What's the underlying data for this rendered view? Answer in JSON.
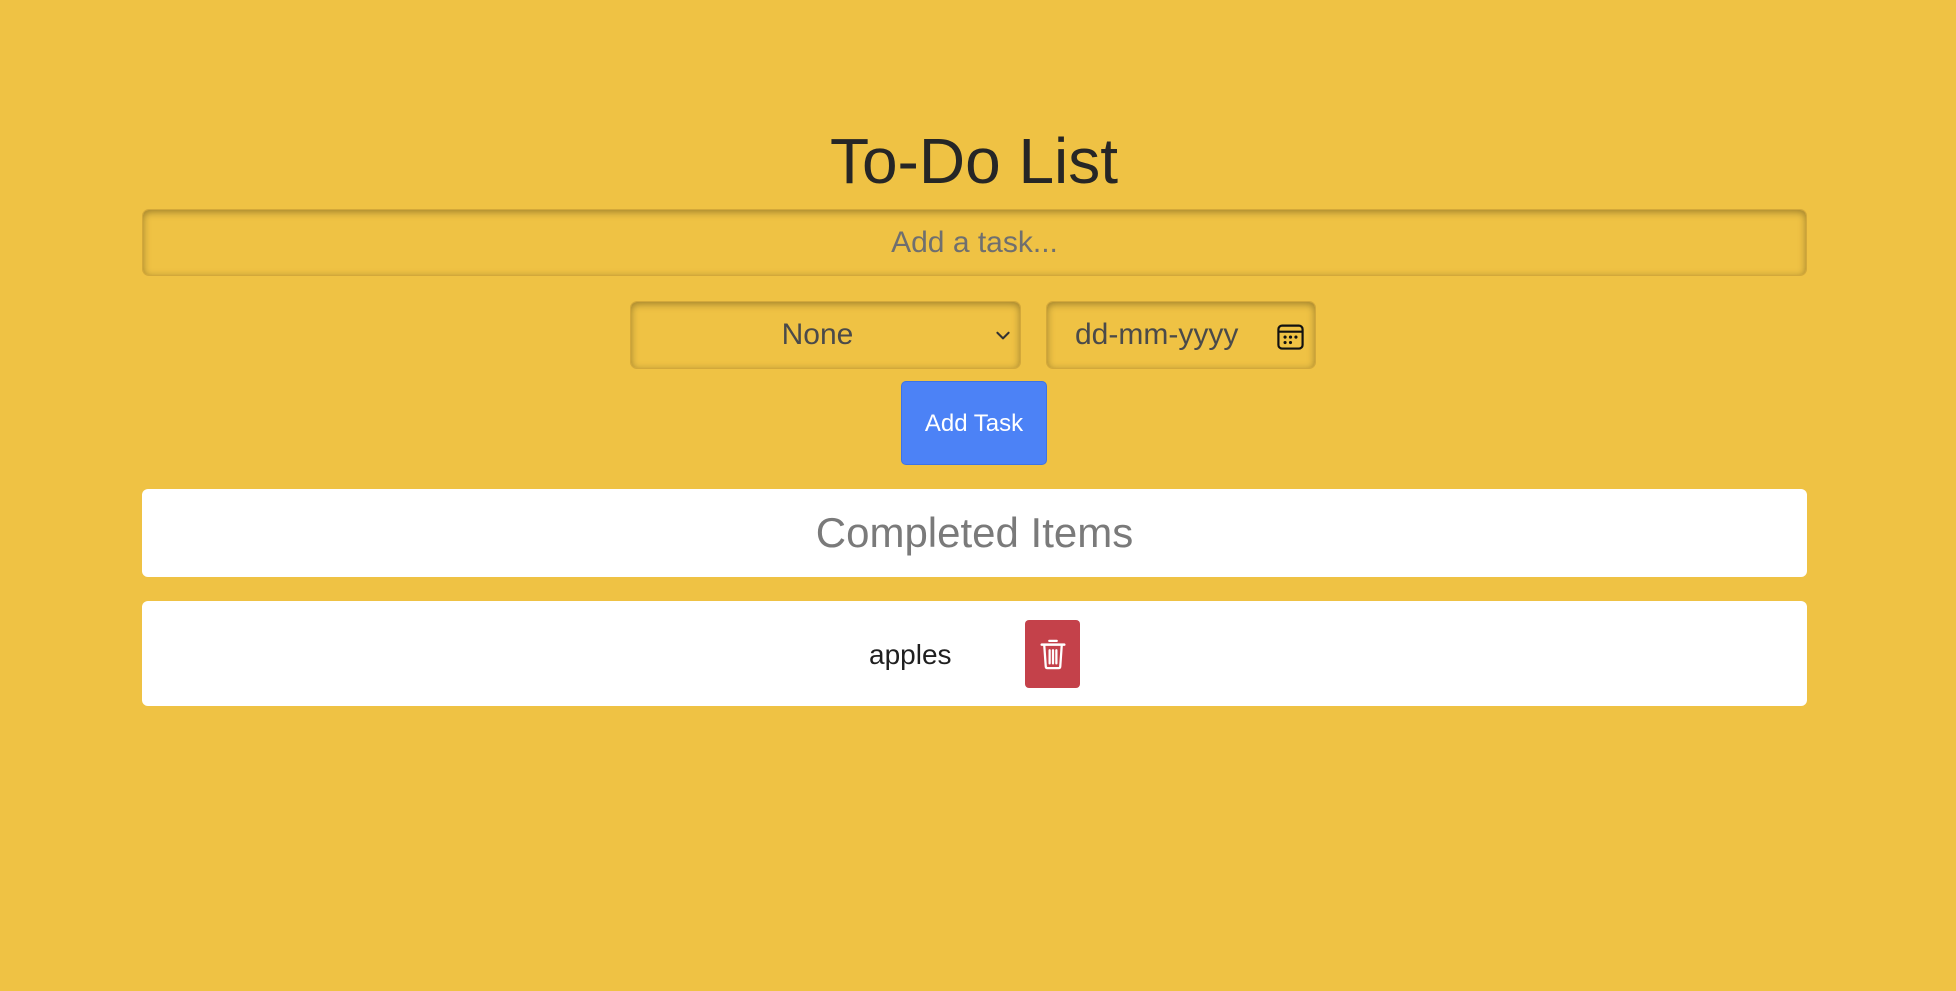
{
  "app": {
    "title": "To-Do List"
  },
  "task_input": {
    "placeholder": "Add a task...",
    "value": ""
  },
  "priority_select": {
    "selected": "None"
  },
  "due_date": {
    "placeholder": "dd-mm-yyyy"
  },
  "add_button": {
    "label": "Add Task"
  },
  "completed_section": {
    "header": "Completed Items",
    "items": [
      {
        "label": "apples"
      }
    ]
  },
  "icons": {
    "priority_dropdown": "chevron-down-icon",
    "date_picker": "calendar-icon",
    "delete": "trash-icon"
  },
  "colors": {
    "background": "#efc244",
    "accent": "#4c82f6",
    "danger": "#c4414a",
    "panel": "#ffffff"
  }
}
